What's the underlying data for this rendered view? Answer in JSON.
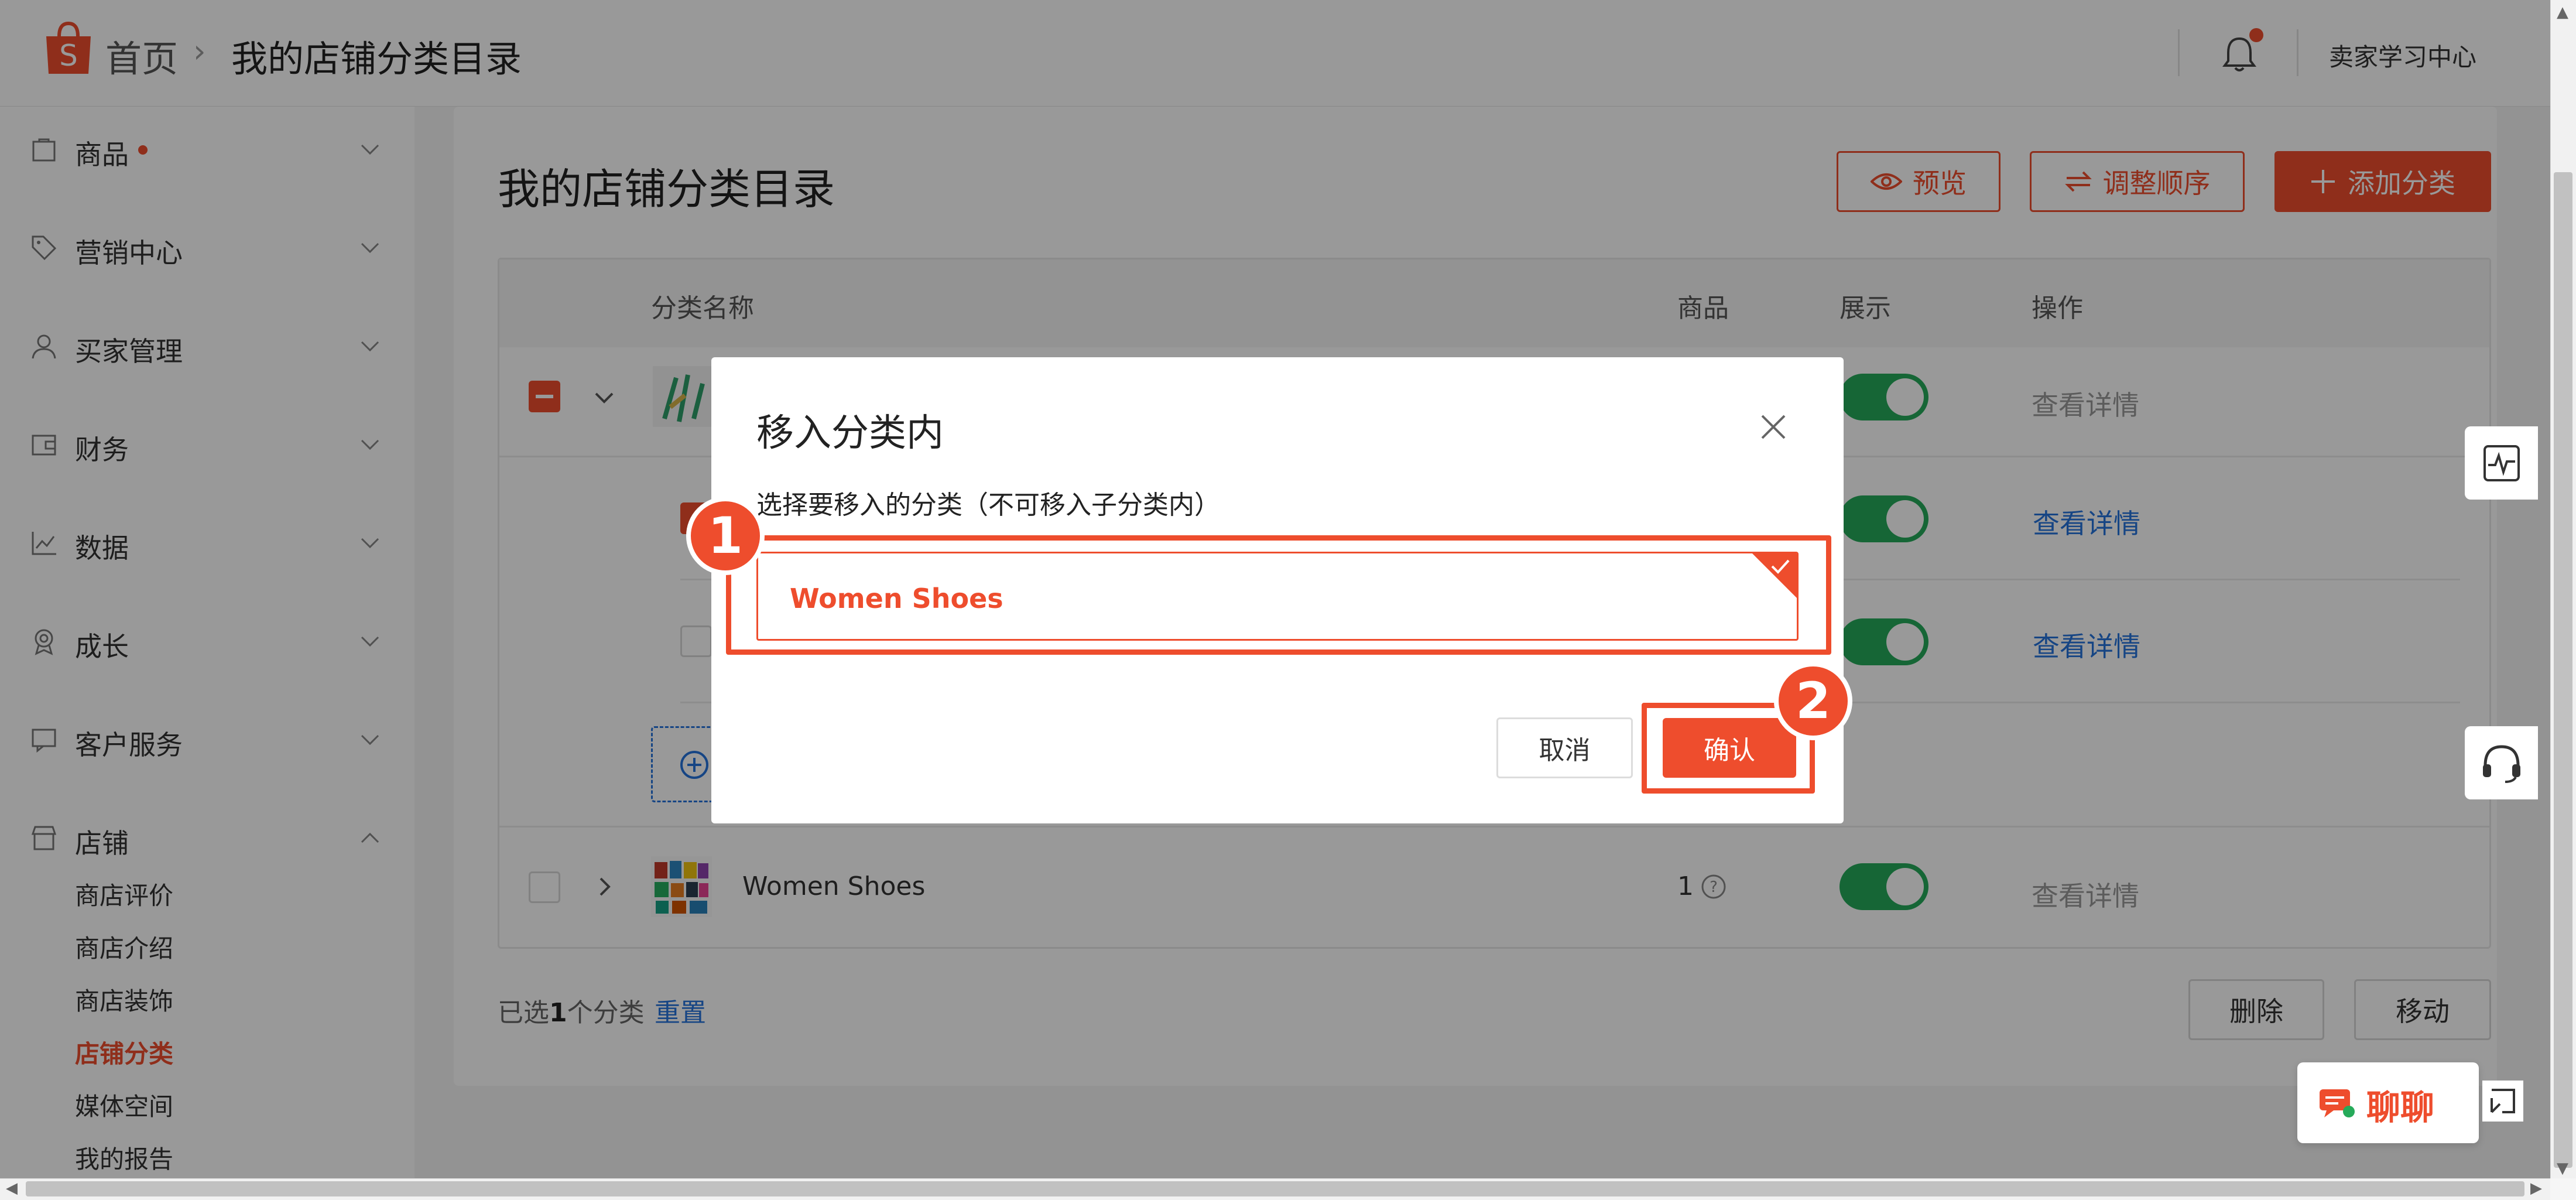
{
  "header": {
    "home": "首页",
    "separator": "›",
    "current": "我的店铺分类目录",
    "learning_center": "卖家学习中心"
  },
  "sidebar": {
    "items": [
      {
        "label": "商品",
        "icon": "bag-icon",
        "has_dot": true
      },
      {
        "label": "营销中心",
        "icon": "tag-icon"
      },
      {
        "label": "买家管理",
        "icon": "user-icon"
      },
      {
        "label": "财务",
        "icon": "wallet-icon"
      },
      {
        "label": "数据",
        "icon": "chart-icon"
      },
      {
        "label": "成长",
        "icon": "badge-icon"
      },
      {
        "label": "客户服务",
        "icon": "chat-icon"
      },
      {
        "label": "店铺",
        "icon": "shop-icon",
        "expanded": true
      }
    ],
    "shop_sub": [
      "商店评价",
      "商店介绍",
      "商店装饰",
      "店铺分类",
      "媒体空间",
      "我的报告"
    ],
    "active_sub": "店铺分类"
  },
  "main": {
    "title": "我的店铺分类目录",
    "preview": "预览",
    "reorder": "调整顺序",
    "add": "添加分类",
    "table": {
      "headers": [
        "分类名称",
        "商品",
        "展示",
        "操作"
      ],
      "detail": "查看详情",
      "row_women_shoes": {
        "name": "Women Shoes",
        "count": "1"
      }
    },
    "footer": {
      "selected_prefix": "已选",
      "selected_count": "1",
      "selected_suffix": "个分类",
      "reset": "重置",
      "delete": "删除",
      "move": "移动"
    }
  },
  "modal": {
    "title": "移入分类内",
    "subtitle": "选择要移入的分类（不可移入子分类内）",
    "option": "Women Shoes",
    "cancel": "取消",
    "confirm": "确认",
    "step1": "1",
    "step2": "2"
  },
  "chat": {
    "label": "聊聊"
  },
  "colors": {
    "accent": "#ee4d2d",
    "toggle": "#26aa5a",
    "link": "#2673dd"
  }
}
